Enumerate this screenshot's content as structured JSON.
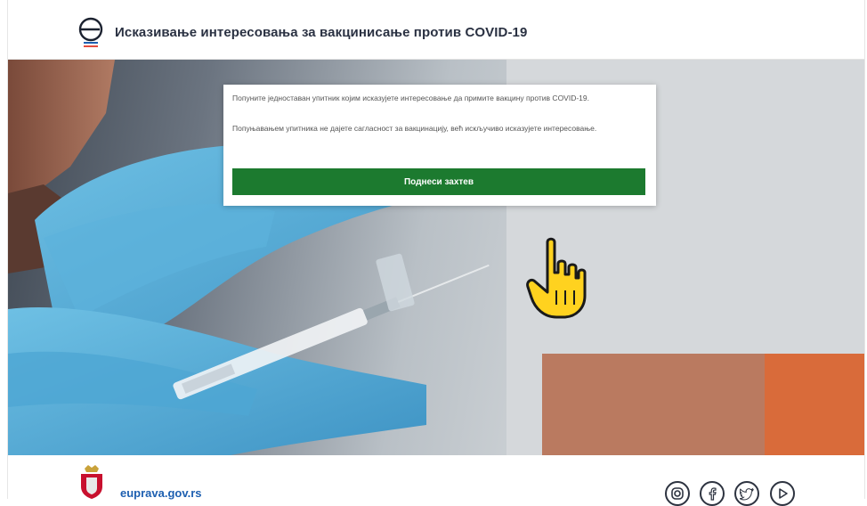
{
  "header": {
    "title": "Исказивање интересовања за вакцинисање против COVID-19",
    "logo_icon": "eprava-e-logo-icon"
  },
  "card": {
    "paragraph_1": "Попуните једноставан упитник којим исказујете интересовање да примите вакцину против COVID-19.",
    "paragraph_2": "Попуњавањем упитника не дајете сагласност за вакцинацију, већ искључиво исказујете интересовање.",
    "submit_label": "Поднеси захтев"
  },
  "footer": {
    "site_name": "euprava.gov.rs",
    "crest_icon": "serbian-coat-of-arms-icon",
    "social_icons": [
      "instagram-icon",
      "facebook-icon",
      "twitter-icon",
      "youtube-icon"
    ]
  },
  "colors": {
    "accent": "#1c7a2f",
    "title_text": "#2a3142",
    "link": "#1d5fb0"
  }
}
